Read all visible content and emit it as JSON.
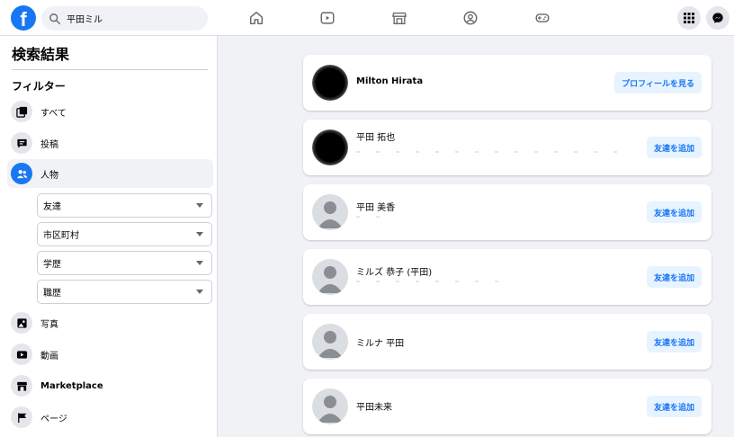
{
  "header": {
    "logo_letter": "f",
    "search": {
      "value": "平田ミル"
    },
    "nav": [
      "home-icon",
      "video-icon",
      "marketplace-icon",
      "groups-icon",
      "gaming-icon"
    ],
    "right": [
      "menu-grid-icon",
      "messenger-icon"
    ],
    "accent_color": "#1877f2"
  },
  "sidebar": {
    "title": "検索結果",
    "filter_heading": "フィルター",
    "items": [
      {
        "label": "すべて",
        "icon": "all-results-icon"
      },
      {
        "label": "投稿",
        "icon": "posts-icon"
      },
      {
        "label": "人物",
        "icon": "people-icon",
        "active": true
      },
      {
        "label": "写真",
        "icon": "photos-icon"
      },
      {
        "label": "動画",
        "icon": "video-icon"
      },
      {
        "label": "Marketplace",
        "icon": "marketplace-icon"
      },
      {
        "label": "ページ",
        "icon": "pages-icon"
      }
    ],
    "people_filters": [
      "友達",
      "市区町村",
      "学歴",
      "職歴"
    ]
  },
  "results": [
    {
      "name": "Milton Hirata",
      "action": "プロフィールを見る",
      "avatar": "blurred-photo"
    },
    {
      "name": "平田 拓也",
      "action": "友達を追加",
      "avatar": "blurred-photo"
    },
    {
      "name": "平田 美香",
      "action": "友達を追加",
      "avatar": "default-avatar"
    },
    {
      "name": "ミルズ 恭子 (平田)",
      "action": "友達を追加",
      "avatar": "default-avatar"
    },
    {
      "name": "ミルナ 平田",
      "action": "友達を追加",
      "avatar": "default-avatar"
    },
    {
      "name": "平田未来",
      "action": "友達を追加",
      "avatar": "default-avatar"
    }
  ]
}
